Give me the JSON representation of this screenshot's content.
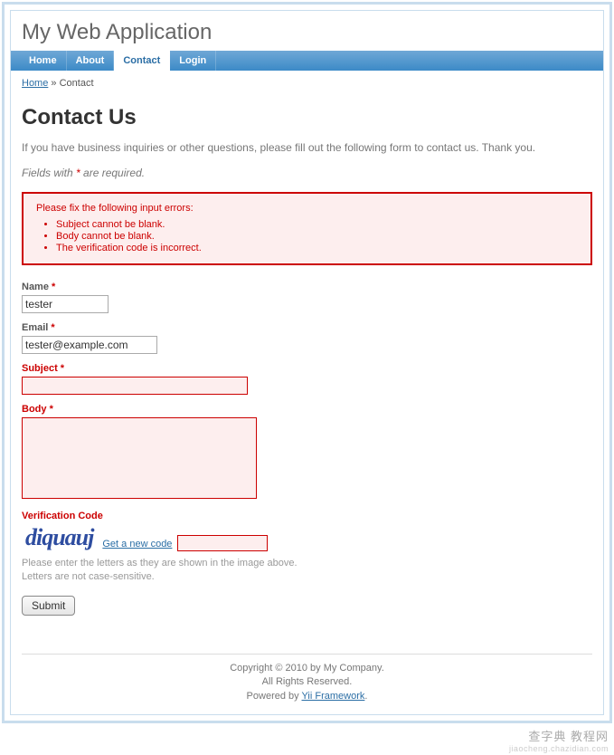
{
  "header": {
    "title": "My Web Application"
  },
  "nav": {
    "items": [
      "Home",
      "About",
      "Contact",
      "Login"
    ],
    "active": "Contact"
  },
  "breadcrumb": {
    "home": "Home",
    "sep": "»",
    "current": "Contact"
  },
  "page": {
    "title": "Contact Us",
    "intro": "If you have business inquiries or other questions, please fill out the following form to contact us. Thank you.",
    "required_note_prefix": "Fields with ",
    "required_star": "*",
    "required_note_suffix": " are required."
  },
  "errors": {
    "heading": "Please fix the following input errors:",
    "items": [
      "Subject cannot be blank.",
      "Body cannot be blank.",
      "The verification code is incorrect."
    ]
  },
  "form": {
    "name": {
      "label": "Name",
      "star": "*",
      "value": "tester",
      "error": false
    },
    "email": {
      "label": "Email",
      "star": "*",
      "value": "tester@example.com",
      "error": false
    },
    "subject": {
      "label": "Subject",
      "star": "*",
      "value": "",
      "error": true
    },
    "body": {
      "label": "Body",
      "star": "*",
      "value": "",
      "error": true
    },
    "captcha": {
      "label": "Verification Code",
      "image_text": "diquauj",
      "refresh": "Get a new code",
      "value": "",
      "hint": "Please enter the letters as they are shown in the image above. Letters are not case-sensitive.",
      "error": true
    },
    "submit": "Submit"
  },
  "footer": {
    "line1": "Copyright © 2010 by My Company.",
    "line2": "All Rights Reserved.",
    "powered_prefix": "Powered by ",
    "powered_link": "Yii Framework",
    "powered_suffix": "."
  },
  "watermark": {
    "main": "查字典 教程网",
    "sub": "jiaocheng.chazidian.com"
  }
}
